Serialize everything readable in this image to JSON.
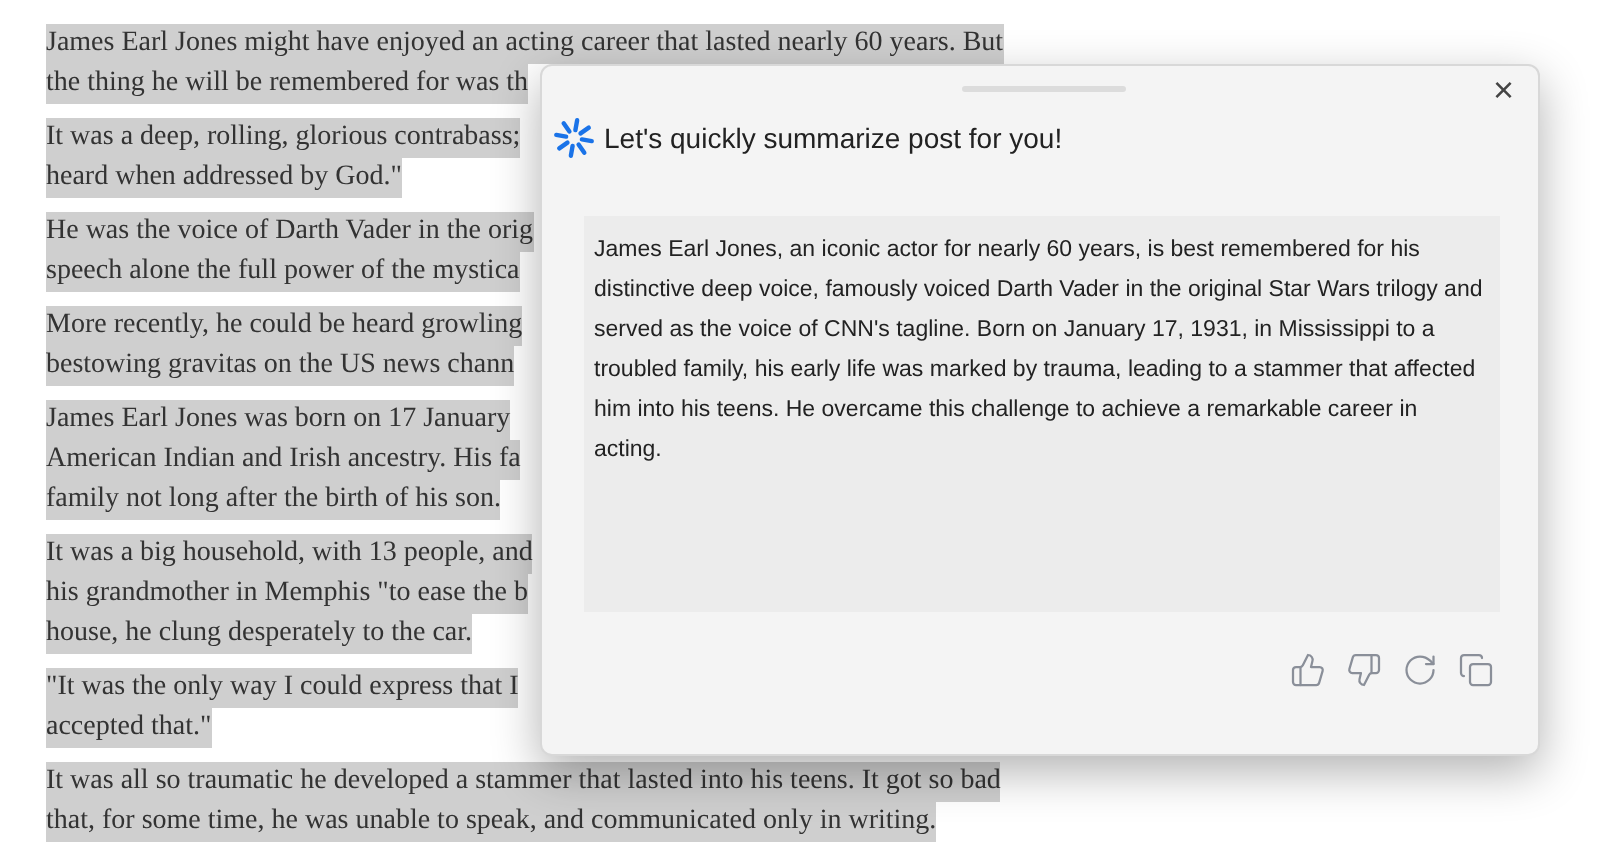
{
  "article": {
    "paragraphs": [
      {
        "lines": [
          "James Earl Jones might have enjoyed an acting career that lasted nearly 60 years. But",
          "the thing he will be remembered for was th"
        ]
      },
      {
        "lines": [
          "It was a deep, rolling, glorious contrabass;",
          "heard when addressed by God.\""
        ]
      },
      {
        "lines": [
          "He was the voice of Darth Vader in the orig",
          "speech alone the full power of the mystica"
        ]
      },
      {
        "lines": [
          "More recently, he could be heard growling",
          "bestowing gravitas on the US news chann"
        ]
      },
      {
        "lines": [
          "James Earl Jones was born on 17 January",
          "American Indian and Irish ancestry. His fa",
          "family not long after the birth of his son."
        ]
      },
      {
        "lines": [
          "It was a big household, with 13 people, and",
          "his grandmother in Memphis \"to ease the b",
          "house, he clung desperately to the car."
        ]
      },
      {
        "lines": [
          "\"It was the only way I could express that I",
          "accepted that.\""
        ]
      },
      {
        "lines": [
          "It was all so traumatic he developed a stammer that lasted into his teens. It got so bad",
          "that, for some time, he was unable to speak, and communicated only in writing."
        ]
      }
    ]
  },
  "popup": {
    "close": "×",
    "title": "Let's quickly summarize post for you!",
    "summary": "James Earl Jones, an iconic actor for nearly 60 years, is best remembered for his distinctive deep voice, famously voiced Darth Vader in the original Star Wars trilogy and served as the voice of CNN's tagline. Born on January 17, 1931, in Mississippi to a troubled family, his early life was marked by trauma, leading to a stammer that affected him into his teens. He overcame this challenge to achieve a remarkable career in acting."
  }
}
